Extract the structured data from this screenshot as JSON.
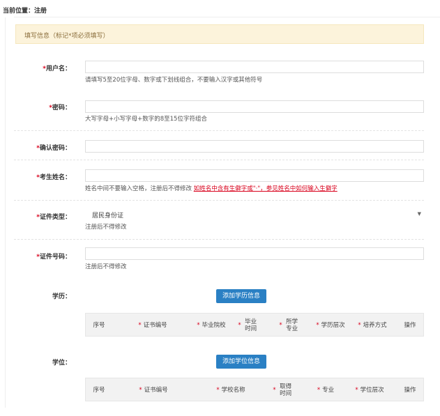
{
  "breadcrumb": "当前位置：注册",
  "notice": "填写信息（标记*项必须填写）",
  "username": {
    "star": "*",
    "label": "用户名：",
    "hint": "请填写5至20位字母、数字或下划线组合，不要输入汉字或其他符号"
  },
  "password": {
    "star": "*",
    "label": "密码：",
    "hint": "大写字母+小写字母+数字的8至15位字符组合"
  },
  "confirm_password": {
    "star": "*",
    "label": "确认密码："
  },
  "name": {
    "star": "*",
    "label": "考生姓名：",
    "hint": "姓名中间不要输入空格，注册后不得修改",
    "link": "如姓名中含有生僻字或\"·\"，参见姓名中如何输入生僻字"
  },
  "id_type": {
    "star": "*",
    "label": "证件类型：",
    "value": "居民身份证",
    "hint": "注册后不得修改"
  },
  "id_number": {
    "star": "*",
    "label": "证件号码：",
    "hint": "注册后不得修改"
  },
  "education": {
    "label": "学历：",
    "button": "添加学历信息",
    "columns": [
      {
        "text": "序号",
        "required": false
      },
      {
        "text": "证书编号",
        "required": true
      },
      {
        "text": "毕业院校",
        "required": true
      },
      {
        "text": "毕业时间",
        "required": true
      },
      {
        "text": "所学专业",
        "required": true
      },
      {
        "text": "学历层次",
        "required": true
      },
      {
        "text": "培养方式",
        "required": true
      },
      {
        "text": "操作",
        "required": false
      }
    ]
  },
  "degree": {
    "label": "学位：",
    "button": "添加学位信息",
    "columns": [
      {
        "text": "序号",
        "required": false
      },
      {
        "text": "证书编号",
        "required": true
      },
      {
        "text": "学校名称",
        "required": true
      },
      {
        "text": "取得时间",
        "required": true
      },
      {
        "text": "专业",
        "required": true
      },
      {
        "text": "学位层次",
        "required": true
      },
      {
        "text": "操作",
        "required": false
      }
    ]
  },
  "colors": {
    "accent": "#2a80c4",
    "required": "#d9001b",
    "notice_bg": "#fcf3db"
  }
}
